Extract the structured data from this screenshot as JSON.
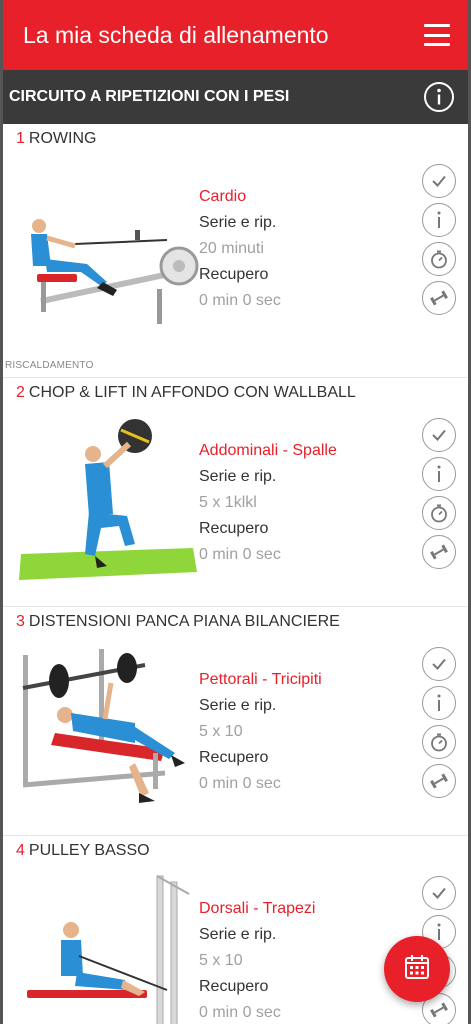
{
  "app": {
    "title": "La mia scheda di allenamento"
  },
  "section": {
    "title": "CIRCUITO A RIPETIZIONI CON I PESI"
  },
  "labels": {
    "sets_reps": "Serie e rip.",
    "rest": "Recupero"
  },
  "exercises": [
    {
      "number": "1",
      "name": "ROWING",
      "muscle": "Cardio",
      "sets_reps": "20 minuti",
      "rest": "0 min 0 sec",
      "tag": "RISCALDAMENTO"
    },
    {
      "number": "2",
      "name": "CHOP & LIFT IN AFFONDO CON WALLBALL",
      "muscle": "Addominali - Spalle",
      "sets_reps": "5 x 1klkl",
      "rest": "0 min 0 sec"
    },
    {
      "number": "3",
      "name": "DISTENSIONI PANCA PIANA BILANCIERE",
      "muscle": "Pettorali - Tricipiti",
      "sets_reps": "5 x 10",
      "rest": "0 min 0 sec"
    },
    {
      "number": "4",
      "name": "PULLEY BASSO",
      "muscle": "Dorsali - Trapezi",
      "sets_reps": "5 x 10",
      "rest": "0 min 0 sec"
    }
  ],
  "colors": {
    "accent": "#e8202a",
    "section_bg": "#3a3a3a",
    "muted": "#a0a0a0"
  },
  "icons": {
    "menu": "hamburger-menu-icon",
    "info": "info-icon",
    "done": "check-icon",
    "timer": "stopwatch-icon",
    "swap": "dumbbell-swap-icon",
    "calendar": "calendar-icon"
  }
}
